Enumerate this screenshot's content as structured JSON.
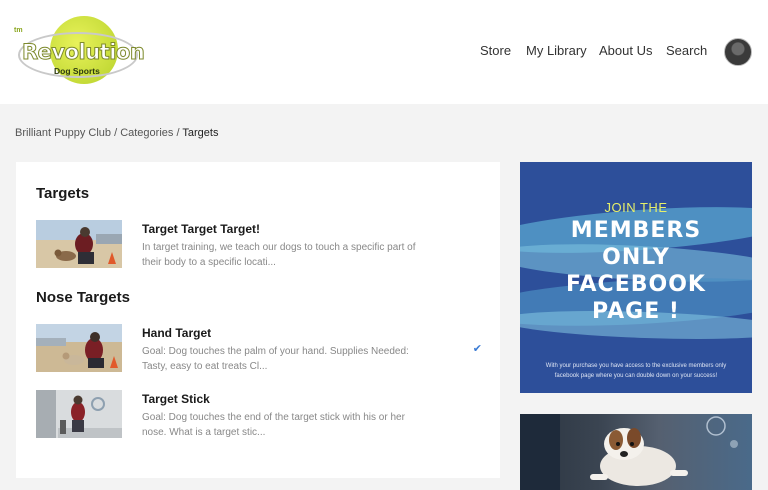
{
  "header": {
    "logo": {
      "tm": "tm",
      "name": "Revolution",
      "sub": "Dog Sports"
    },
    "nav": [
      {
        "label": "Store"
      },
      {
        "label": "My Library"
      },
      {
        "label": "About Us"
      },
      {
        "label": "Search"
      }
    ]
  },
  "breadcrumb": {
    "items": [
      "Brilliant Puppy Club",
      "Categories"
    ],
    "separator": "/",
    "current": "Targets"
  },
  "main": {
    "sections": [
      {
        "title": "Targets",
        "lessons": [
          {
            "title": "Target Target Target!",
            "description": "In target training, we teach our dogs to touch a specific part of their body to a specific locati...",
            "completed": false
          }
        ]
      },
      {
        "title": "Nose Targets",
        "lessons": [
          {
            "title": "Hand Target",
            "description": "Goal:  Dog touches the palm of your hand. Supplies Needed: Tasty, easy to eat treats Cl...",
            "completed": true
          },
          {
            "title": "Target Stick",
            "description": "Goal:  Dog touches the end of the target stick with his or her nose. What is a target stic...",
            "completed": false
          }
        ]
      }
    ]
  },
  "promo": {
    "join": "JOIN THE",
    "line1": "MEMBERS",
    "line2": "ONLY",
    "line3": "FACEBOOK",
    "line4": "PAGE !",
    "small": "With your purchase you have access to the exclusive members only facebook page where you can double down on your success!",
    "colors": {
      "background": "#2d4f9a",
      "accent": "#e6ef6a"
    }
  },
  "icons": {
    "check": "✔"
  }
}
